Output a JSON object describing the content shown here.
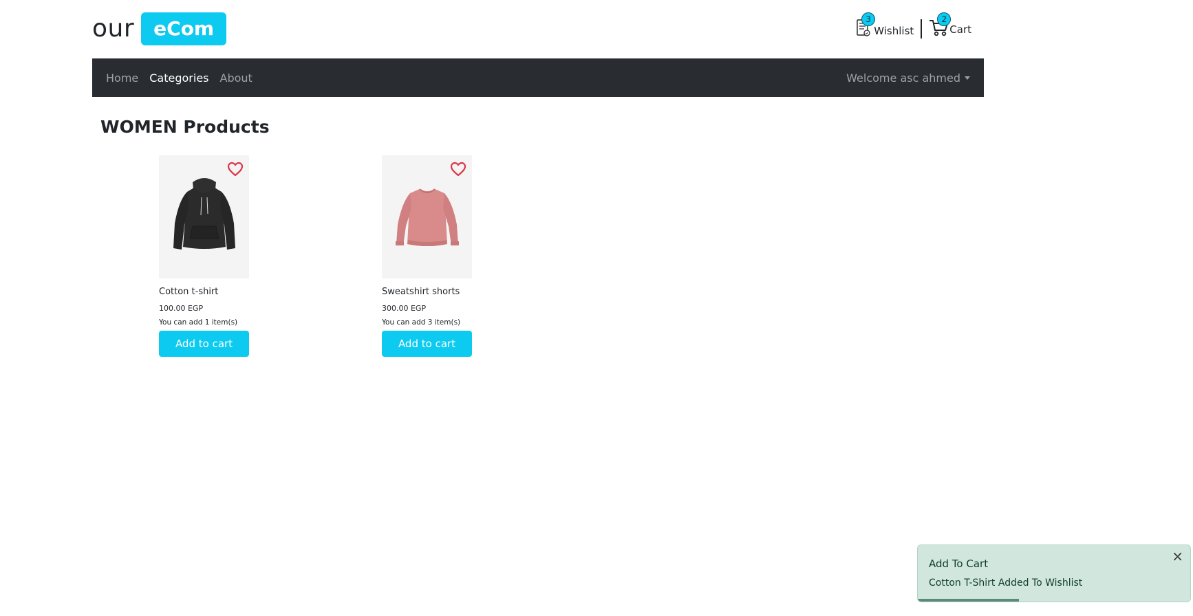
{
  "header": {
    "logo_text": "our",
    "logo_badge": "eCom",
    "wishlist": {
      "label": "Wishlist",
      "count": "3"
    },
    "cart": {
      "label": "Cart",
      "count": "2"
    }
  },
  "navbar": {
    "items": [
      {
        "label": "Home",
        "active": false
      },
      {
        "label": "Categories",
        "active": true
      },
      {
        "label": "About",
        "active": false
      }
    ],
    "user_menu": "Welcome asc ahmed"
  },
  "page": {
    "title": "WOMEN Products"
  },
  "products": [
    {
      "name": "Cotton t-shirt",
      "price": "100.00 EGP",
      "stock": "You can add 1 item(s)",
      "button": "Add to cart",
      "image_icon": "black-hoodie-image",
      "color": "#2b2b2b"
    },
    {
      "name": "Sweatshirt shorts",
      "price": "300.00 EGP",
      "stock": "You can add 3 item(s)",
      "button": "Add to cart",
      "image_icon": "pink-sweatshirt-image",
      "color": "#d98a8a"
    }
  ],
  "toast": {
    "title": "Add To Cart",
    "message": "Cotton T-Shirt Added To Wishlist",
    "close": "×",
    "progress": 0.37
  },
  "colors": {
    "accent": "#0dcaf0",
    "navbar_bg": "#292d32",
    "heart": "#dc3545",
    "toast_bg": "#d1e7dd"
  }
}
